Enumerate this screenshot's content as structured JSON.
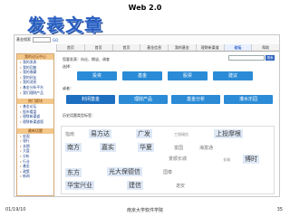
{
  "header": {
    "title": "Web 2.0"
  },
  "slide": {
    "title": "发表文章"
  },
  "screenshot": {
    "topbar": {
      "label": "基金搜索",
      "go": "GO"
    },
    "nav": [
      {
        "label": "首页",
        "active": false
      },
      {
        "label": "首页",
        "active": false
      },
      {
        "label": "首页",
        "active": false
      },
      {
        "label": "基金信息",
        "active": false
      },
      {
        "label": "我的基金",
        "active": false
      },
      {
        "label": "理财新渠道",
        "active": false
      },
      {
        "label": "论坛",
        "active": true
      },
      {
        "label": "帮助",
        "active": false
      }
    ],
    "sidebar": {
      "group1_title": "我的论坛中心",
      "group1_items": [
        "我的发表",
        "我的回复",
        "我的收藏",
        "我的好友",
        "我的消息",
        "基金分析平台",
        "我们理财产品"
      ],
      "group2_title": "热门版块",
      "group2_items": [
        "基金论坛",
        "股市看盘",
        "理财新渠道",
        "理财新渠道版"
      ],
      "group3_title": "最新话题",
      "group3_items": [
        "宏观",
        "银行",
        "长期",
        "大盘",
        "分析",
        "行业",
        "基金",
        "政策",
        "新闻"
      ]
    },
    "main": {
      "search_button": "搜索",
      "post_prompt": "您要发表：向论、期谈、调查",
      "select_section": "选择：",
      "categories": [
        "投资",
        "基金",
        "股票",
        "建议"
      ],
      "sub_label": "或者：",
      "subcats": [
        "封闭基金",
        "理财产品",
        "基金分析",
        "灌水乐园"
      ],
      "tags_label": "历史话题类型标签：",
      "tags": [
        {
          "text": "指南",
          "size": "mid"
        },
        {
          "text": "易方达",
          "size": "big"
        },
        {
          "text": "广发",
          "size": "big"
        },
        {
          "text": "工银瑞信",
          "size": "sm"
        },
        {
          "text": "上投摩根",
          "size": "big"
        },
        {
          "text": "南方",
          "size": "big"
        },
        {
          "text": "嘉实",
          "size": "big"
        },
        {
          "text": "华夏",
          "size": "big"
        },
        {
          "text": "富国",
          "size": "mid"
        },
        {
          "text": "海富通",
          "size": "mid"
        },
        {
          "text": "景顺长城",
          "size": "mid"
        },
        {
          "text": "长城",
          "size": "sm"
        },
        {
          "text": "博时",
          "size": "big"
        },
        {
          "text": "东方",
          "size": "big"
        },
        {
          "text": "光大保德信",
          "size": "big"
        },
        {
          "text": "国泰",
          "size": "mid"
        },
        {
          "text": "华宝兴业",
          "size": "big"
        },
        {
          "text": "建信",
          "size": "big"
        },
        {
          "text": "诺安",
          "size": "mid"
        }
      ]
    }
  },
  "footer": {
    "date": "01/19/10",
    "center": "南京大学软件学院",
    "page": "35"
  }
}
